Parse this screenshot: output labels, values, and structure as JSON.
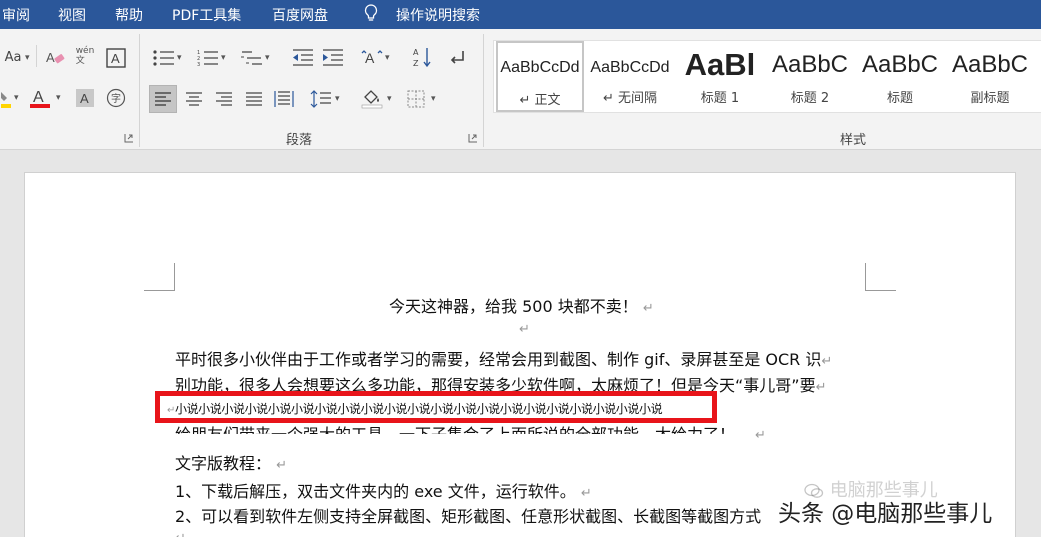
{
  "menu": {
    "items": [
      "审阅",
      "视图",
      "帮助",
      "PDF工具集",
      "百度网盘",
      "操作说明搜索"
    ]
  },
  "ribbon": {
    "font_partial": "Aa",
    "phonetic_label": "wén\n文",
    "paragraph_group_label": "段落",
    "styles_group_label": "样式",
    "styles": [
      {
        "preview": "AaBbCcDd",
        "name": "↵ 正文"
      },
      {
        "preview": "AaBbCcDd",
        "name": "↵ 无间隔"
      },
      {
        "preview": "AaBl",
        "name": "标题 1"
      },
      {
        "preview": "AaBbC",
        "name": "标题 2"
      },
      {
        "preview": "AaBbC",
        "name": "标题"
      },
      {
        "preview": "AaBbC",
        "name": "副标题"
      }
    ],
    "colors": {
      "accent": "#2b579a",
      "font_color": "#e8141a",
      "highlight": "#ffd400"
    }
  },
  "document": {
    "title": "今天这神器，给我 500 块都不卖！",
    "para_mark": "↵",
    "lines": [
      "平时很多小伙伴由于工作或者学习的需要，经常会用到截图、制作 gif、录屏甚至是 OCR 识",
      "别功能，很多人会想要这么多功能，那得安装多少软件啊，太麻烦了！但是今天“事儿哥”要",
      "给朋友们带来一个强大的工具，一下子集合了上面所说的全部功能，太给力了！",
      "文字版教程：",
      "1、下载后解压，双击文件夹内的 exe 文件，运行软件。",
      "2、可以看到软件左侧支持全屏截图、矩形截图、任意形状截图、长截图等截图方式"
    ],
    "overlay_text": "小说小说小说小说小说小说小说小说小说小说小说小说小说小说小说小说小说小说小说小说小说"
  },
  "watermark": {
    "faint": "电脑那些事儿",
    "main": "头条 @电脑那些事儿"
  }
}
